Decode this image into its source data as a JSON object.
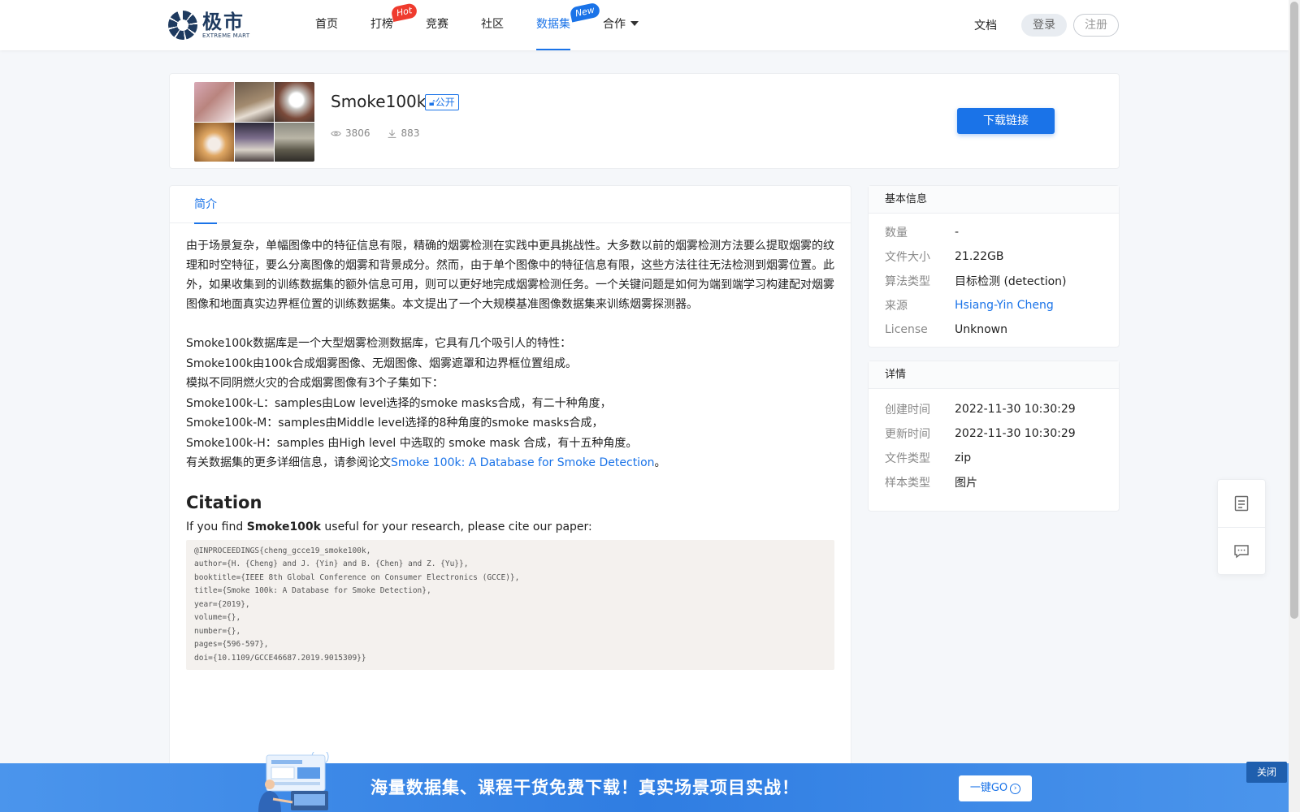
{
  "header": {
    "logo_cn": "极市",
    "logo_en": "EXTREME MART",
    "nav": [
      {
        "label": "首页"
      },
      {
        "label": "打榜",
        "badge": "Hot"
      },
      {
        "label": "竞赛"
      },
      {
        "label": "社区"
      },
      {
        "label": "数据集",
        "badge": "New",
        "active": true
      },
      {
        "label": "合作"
      }
    ],
    "docs": "文档",
    "login": "登录",
    "register": "注册"
  },
  "dataset": {
    "title": "Smoke100k",
    "visibility": "公开",
    "views": "3806",
    "downloads": "883",
    "download_button": "下载链接"
  },
  "tabs": {
    "intro": "简介"
  },
  "intro": {
    "para1": "由于场景复杂，单幅图像中的特征信息有限，精确的烟雾检测在实践中更具挑战性。大多数以前的烟雾检测方法要么提取烟雾的纹理和时空特征，要么分离图像的烟雾和背景成分。然而，由于单个图像中的特征信息有限，这些方法往往无法检测到烟雾位置。此外，如果收集到的训练数据集的额外信息可用，则可以更好地完成烟雾检测任务。一个关键问题是如何为端到端学习构建配对烟雾图像和地面真实边界框位置的训练数据集。本文提出了一个大规模基准图像数据集来训练烟雾探测器。",
    "lines": [
      "Smoke100k数据库是一个大型烟雾检测数据库，它具有几个吸引人的特性：",
      "Smoke100k由100k合成烟雾图像、无烟图像、烟雾遮罩和边界框位置组成。",
      "模拟不同阴燃火灾的合成烟雾图像有3个子集如下：",
      "Smoke100k-L：samples由Low level选择的smoke masks合成，有二十种角度，",
      "Smoke100k-M：samples由Middle level选择的8种角度的smoke masks合成，",
      "Smoke100k-H：samples 由High level 中选取的 smoke mask 合成，有十五种角度。"
    ],
    "paper_prefix": "有关数据集的更多详细信息，请参阅论文",
    "paper_link": "Smoke 100k: A Database for Smoke Detection",
    "paper_suffix": "。"
  },
  "citation": {
    "heading": "Citation",
    "intro_before": "If you find ",
    "intro_bold": "Smoke100k",
    "intro_after": " useful for your research, please cite our paper:",
    "code": [
      "@INPROCEEDINGS{cheng_gcce19_smoke100k,",
      "author={H. {Cheng} and J. {Yin} and B. {Chen} and Z. {Yu}},",
      "booktitle={IEEE 8th Global Conference on Consumer Electronics (GCCE)},",
      "title={Smoke 100k: A Database for Smoke Detection},",
      "year={2019},",
      "volume={},",
      "number={},",
      "pages={596-597},",
      "doi={10.1109/GCCE46687.2019.9015309}}"
    ]
  },
  "basic_info": {
    "title": "基本信息",
    "rows": [
      {
        "key": "数量",
        "value": "-"
      },
      {
        "key": "文件大小",
        "value": "21.22GB"
      },
      {
        "key": "算法类型",
        "value": "目标检测 (detection)"
      },
      {
        "key": "来源",
        "value": "Hsiang-Yin Cheng",
        "link": true
      },
      {
        "key": "License",
        "value": "Unknown"
      }
    ]
  },
  "details": {
    "title": "详情",
    "rows": [
      {
        "key": "创建时间",
        "value": "2022-11-30 10:30:29"
      },
      {
        "key": "更新时间",
        "value": "2022-11-30 10:30:29"
      },
      {
        "key": "文件类型",
        "value": "zip"
      },
      {
        "key": "样本类型",
        "value": "图片"
      }
    ]
  },
  "banner": {
    "text": "海量数据集、课程干货免费下载！真实场景项目实战！",
    "go": "一键GO",
    "close": "关闭"
  },
  "colors": {
    "accent": "#1a73e8",
    "hot": "#ef3b2e",
    "brand": "#1e3a5f"
  },
  "icons": {
    "views": "eye-icon",
    "downloads": "download-icon",
    "dropdown": "chevron-down-icon",
    "float_top": "document-icon",
    "float_bottom": "message-icon",
    "go": "arrow-circle-icon"
  }
}
